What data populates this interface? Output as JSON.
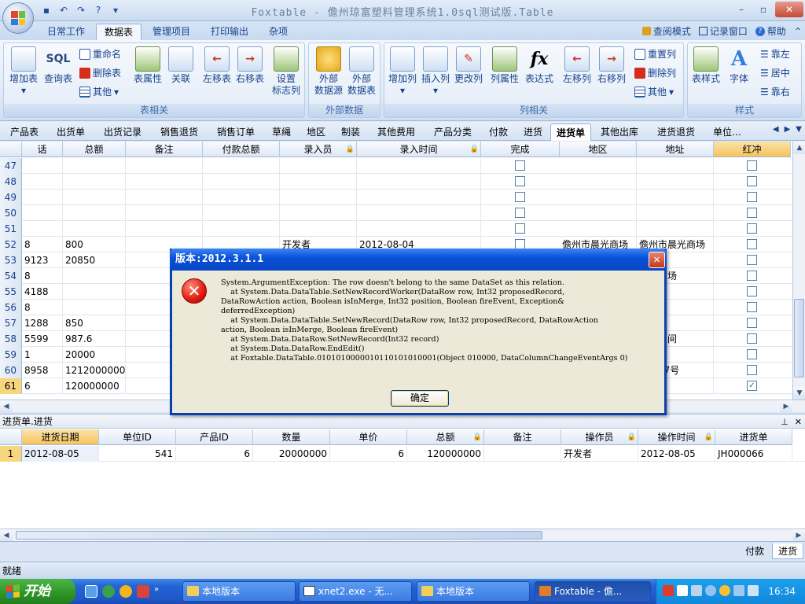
{
  "window": {
    "title": "Foxtable - 儋州琼富塑料管理系统1.0sql测试版.Table",
    "minimize": "–",
    "restore": "▫",
    "close": "✕"
  },
  "ribbon_tabs": [
    {
      "label": "日常工作",
      "active": false
    },
    {
      "label": "数据表",
      "active": true
    },
    {
      "label": "管理项目",
      "active": false
    },
    {
      "label": "打印输出",
      "active": false
    },
    {
      "label": "杂项",
      "active": false
    }
  ],
  "ribbon_right": {
    "view_mode": "查阅模式",
    "record_window": "记录窗口",
    "help": "帮助"
  },
  "groups": {
    "table": {
      "label": "表相关",
      "buttons": [
        "增加表",
        "查询表",
        "表属性",
        "关联",
        "左移表",
        "右移表",
        "设置\n标志列"
      ],
      "small": [
        "重命名",
        "删除表",
        "其他"
      ]
    },
    "external": {
      "label": "外部数据",
      "buttons": [
        "外部\n数据源",
        "外部\n数据表"
      ]
    },
    "column": {
      "label": "列相关",
      "buttons": [
        "增加列",
        "插入列",
        "更改列",
        "列属性",
        "表达式",
        "左移列",
        "右移列"
      ],
      "small": [
        "重置列",
        "删除列",
        "其他"
      ]
    },
    "style": {
      "label": "样式",
      "buttons": [
        "表样式",
        "字体"
      ],
      "small": [
        "靠左",
        "居中",
        "靠右"
      ]
    }
  },
  "sheet_tabs": [
    "产品表",
    "出货单",
    "出货记录",
    "销售退货",
    "销售订单",
    "草绳",
    "地区",
    "制装",
    "其他费用",
    "产品分类",
    "付款",
    "进货",
    "进货单",
    "其他出库",
    "进货退货",
    "单位…"
  ],
  "active_sheet": "进货单",
  "main_grid": {
    "columns": [
      "话",
      "总额",
      "备注",
      "付款总额",
      "录入员",
      "录入时间",
      "完成",
      "地区",
      "地址",
      "红冲"
    ],
    "rows": [
      {
        "n": "47",
        "c": [
          "",
          "",
          "",
          "",
          "",
          "",
          "",
          "",
          "",
          ""
        ],
        "done": false,
        "red": false
      },
      {
        "n": "48",
        "c": [
          "",
          "",
          "",
          "",
          "",
          "",
          "",
          "",
          "",
          ""
        ],
        "done": false,
        "red": false
      },
      {
        "n": "49",
        "c": [
          "",
          "",
          "",
          "",
          "",
          "",
          "",
          "",
          "",
          ""
        ],
        "done": false,
        "red": false
      },
      {
        "n": "50",
        "c": [
          "",
          "",
          "",
          "",
          "",
          "",
          "",
          "",
          "",
          ""
        ],
        "done": false,
        "red": false
      },
      {
        "n": "51",
        "c": [
          "",
          "",
          "",
          "",
          "",
          "",
          "",
          "",
          "",
          ""
        ],
        "done": false,
        "red": false
      },
      {
        "n": "52",
        "c": [
          "8",
          "800",
          "",
          "",
          "开发者",
          "2012-08-04",
          "",
          "儋州市晨光商场",
          "儋州市晨光商场",
          ""
        ],
        "done": false,
        "red": false
      },
      {
        "n": "53",
        "c": [
          "9123",
          "20850",
          "",
          "",
          "",
          "",
          "",
          "",
          "",
          ""
        ],
        "done": false,
        "red": false
      },
      {
        "n": "54",
        "c": [
          "8",
          "",
          "",
          "",
          "",
          "",
          "",
          "",
          "晨光商场",
          ""
        ],
        "done": false,
        "red": false
      },
      {
        "n": "55",
        "c": [
          "4188",
          "",
          "",
          "",
          "",
          "",
          "",
          "",
          "",
          ""
        ],
        "done": false,
        "red": false
      },
      {
        "n": "56",
        "c": [
          "8",
          "",
          "",
          "",
          "",
          "",
          "",
          "",
          "",
          ""
        ],
        "done": false,
        "red": false
      },
      {
        "n": "57",
        "c": [
          "1288",
          "850",
          "",
          "",
          "",
          "",
          "",
          "",
          "",
          ""
        ],
        "done": false,
        "red": false
      },
      {
        "n": "58",
        "c": [
          "5599",
          "987.6",
          "",
          "",
          "",
          "",
          "",
          "",
          "门第三间",
          ""
        ],
        "done": false,
        "red": false
      },
      {
        "n": "59",
        "c": [
          "1",
          "20000",
          "",
          "",
          "",
          "",
          "",
          "",
          "",
          ""
        ],
        "done": false,
        "red": false
      },
      {
        "n": "60",
        "c": [
          "8958",
          "1212000000",
          "",
          "",
          "",
          "",
          "",
          "",
          "明街17号",
          ""
        ],
        "done": false,
        "red": false
      },
      {
        "n": "61",
        "c": [
          "6",
          "120000000",
          "",
          "",
          "",
          "",
          "",
          "",
          "",
          ""
        ],
        "done": false,
        "red": true
      }
    ]
  },
  "dialog": {
    "title": "版本:2012.3.1.1",
    "close": "✕",
    "icon": "error-icon",
    "message": "System.ArgumentException: The row doesn't belong to the same DataSet as this relation.\n    at System.Data.DataTable.SetNewRecordWorker(DataRow row, Int32 proposedRecord,\nDataRowAction action, Boolean isInMerge, Int32 position, Boolean fireEvent, Exception&\ndeferredException)\n    at System.Data.DataTable.SetNewRecord(DataRow row, Int32 proposedRecord, DataRowAction\naction, Boolean isInMerge, Boolean fireEvent)\n    at System.Data.DataRow.SetNewRecord(Int32 record)\n    at System.Data.DataRow.EndEdit()\n    at Foxtable.DataTable.0101010000010110101010001(Object 010000, DataColumnChangeEventArgs 0)",
    "ok": "确定"
  },
  "detail_panel": {
    "title": "进货单.进货",
    "pin": "⊥",
    "close": "✕",
    "columns": [
      "进货日期",
      "单位ID",
      "产品ID",
      "数量",
      "单价",
      "总额",
      "备注",
      "操作员",
      "操作时间",
      "进货单"
    ],
    "rows": [
      {
        "n": "1",
        "c": [
          "2012-08-05",
          "541",
          "6",
          "20000000",
          "6",
          "120000000",
          "",
          "开发者",
          "2012-08-05",
          "JH000066"
        ]
      }
    ]
  },
  "bottom_tabs": [
    "付款",
    "进货"
  ],
  "status": "就绪",
  "taskbar": {
    "start": "开始",
    "items": [
      "本地版本",
      "xnet2.exe - 无...",
      "本地版本",
      "Foxtable - 儋..."
    ],
    "clock": "16:34"
  }
}
